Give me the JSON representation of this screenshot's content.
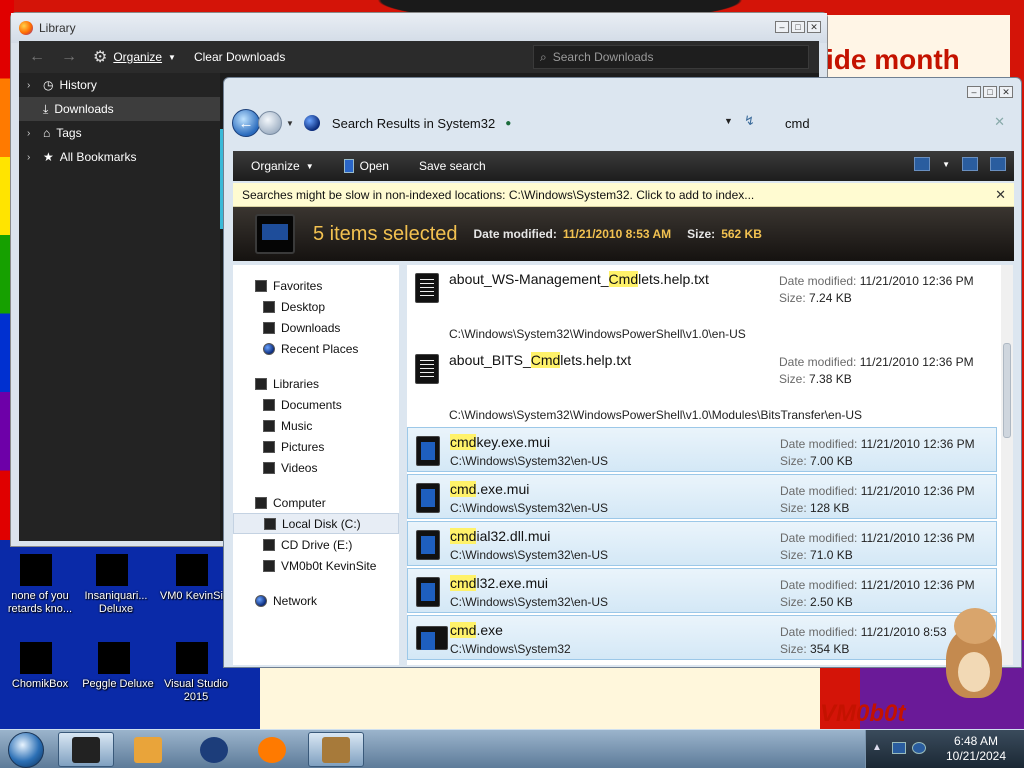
{
  "wallpaper": {
    "banner_text": "ide month",
    "logo_text": "VM0b0t"
  },
  "desktop_icons": [
    {
      "label": "none of you retards kno..."
    },
    {
      "label": "Insaniquari... Deluxe"
    },
    {
      "label": "VM0 KevinSi..."
    },
    {
      "label": "ChomikBox"
    },
    {
      "label": "Peggle Deluxe"
    },
    {
      "label": "Visual Studio 2015"
    }
  ],
  "library": {
    "title": "Library",
    "organize_label": "Organize",
    "clear_label": "Clear Downloads",
    "search_placeholder": "Search Downloads",
    "sidebar": [
      {
        "label": "History",
        "expandable": true
      },
      {
        "label": "Downloads",
        "expandable": false,
        "selected": true
      },
      {
        "label": "Tags",
        "expandable": true
      },
      {
        "label": "All Bookmarks",
        "expandable": true
      }
    ]
  },
  "explorer": {
    "address_text": "Search Results in System32",
    "search_value": "cmd",
    "commands": {
      "organize": "Organize",
      "open": "Open",
      "save_search": "Save search"
    },
    "info_message": "Searches might be slow in non-indexed locations: C:\\Windows\\System32. Click to add to index...",
    "details": {
      "selected_count": "5 items selected",
      "date_label": "Date modified:",
      "date_value": "11/21/2010 8:53 AM",
      "size_label": "Size:",
      "size_value": "562 KB"
    },
    "nav": {
      "favorites": "Favorites",
      "desktop": "Desktop",
      "downloads": "Downloads",
      "recent": "Recent Places",
      "libraries": "Libraries",
      "documents": "Documents",
      "music": "Music",
      "pictures": "Pictures",
      "videos": "Videos",
      "computer": "Computer",
      "local_disk": "Local Disk (C:)",
      "cd_drive": "CD Drive (E:)",
      "vm_site": "VM0b0t KevinSite",
      "network": "Network"
    },
    "results": [
      {
        "pre": "about_WS-Management_",
        "hit": "Cmd",
        "post": "lets.help.txt",
        "path": "C:\\Windows\\System32\\WindowsPowerShell\\v1.0\\en-US",
        "date": "11/21/2010 12:36 PM",
        "size": "7.24 KB",
        "selected": false
      },
      {
        "pre": "about_BITS_",
        "hit": "Cmd",
        "post": "lets.help.txt",
        "path": "C:\\Windows\\System32\\WindowsPowerShell\\v1.0\\Modules\\BitsTransfer\\en-US",
        "date": "11/21/2010 12:36 PM",
        "size": "7.38 KB",
        "selected": false
      },
      {
        "pre": "",
        "hit": "cmd",
        "post": "key.exe.mui",
        "path": "C:\\Windows\\System32\\en-US",
        "date": "11/21/2010 12:36 PM",
        "size": "7.00 KB",
        "selected": true
      },
      {
        "pre": "",
        "hit": "cmd",
        "post": ".exe.mui",
        "path": "C:\\Windows\\System32\\en-US",
        "date": "11/21/2010 12:36 PM",
        "size": "128 KB",
        "selected": true
      },
      {
        "pre": "",
        "hit": "cmd",
        "post": "ial32.dll.mui",
        "path": "C:\\Windows\\System32\\en-US",
        "date": "11/21/2010 12:36 PM",
        "size": "71.0 KB",
        "selected": true
      },
      {
        "pre": "",
        "hit": "cmd",
        "post": "l32.exe.mui",
        "path": "C:\\Windows\\System32\\en-US",
        "date": "11/21/2010 12:36 PM",
        "size": "2.50 KB",
        "selected": true
      },
      {
        "pre": "",
        "hit": "cmd",
        "post": ".exe",
        "path": "C:\\Windows\\System32",
        "date": "11/21/2010 8:53",
        "size": "354 KB",
        "selected": true
      }
    ],
    "date_key": "Date modified:",
    "size_key": "Size:"
  },
  "taskbar": {
    "time": "6:48 AM",
    "date": "10/21/2024",
    "buttons": [
      {
        "name": "explorer",
        "color": "#222222",
        "active": true
      },
      {
        "name": "media-player",
        "color": "#e9a43a",
        "active": false
      },
      {
        "name": "globe-app",
        "color": "#1c3d7a",
        "active": false
      },
      {
        "name": "firefox",
        "color": "#ff7a00",
        "active": false
      },
      {
        "name": "chomikbox",
        "color": "#a77a3a",
        "active": true
      }
    ]
  }
}
